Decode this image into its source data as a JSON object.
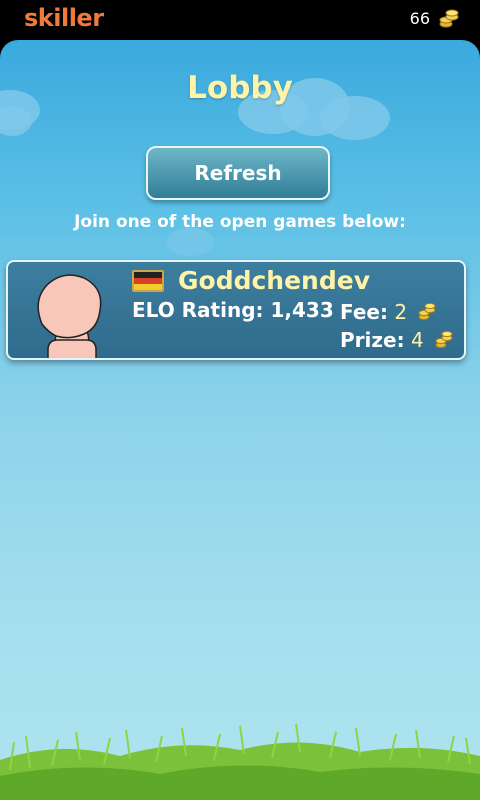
{
  "topbar": {
    "logo": "skiller",
    "coins": "66",
    "coin_icon": "coins-icon"
  },
  "lobby": {
    "title": "Lobby",
    "refresh_label": "Refresh",
    "instructions": "Join one of the open games below:"
  },
  "games": [
    {
      "player_name": "Goddchendev",
      "flag_icon": "germany-flag-icon",
      "elo_label": "ELO Rating: 1,433",
      "fee_label": "Fee:",
      "fee_value": "2",
      "prize_label": "Prize:",
      "prize_value": "4",
      "avatar_icon": "default-avatar-icon"
    }
  ],
  "colors": {
    "brand": "#ef7a3a",
    "accent_text": "#fff3a8",
    "card_bg": "#2f6b8d",
    "sky": "#5cc0e6"
  }
}
